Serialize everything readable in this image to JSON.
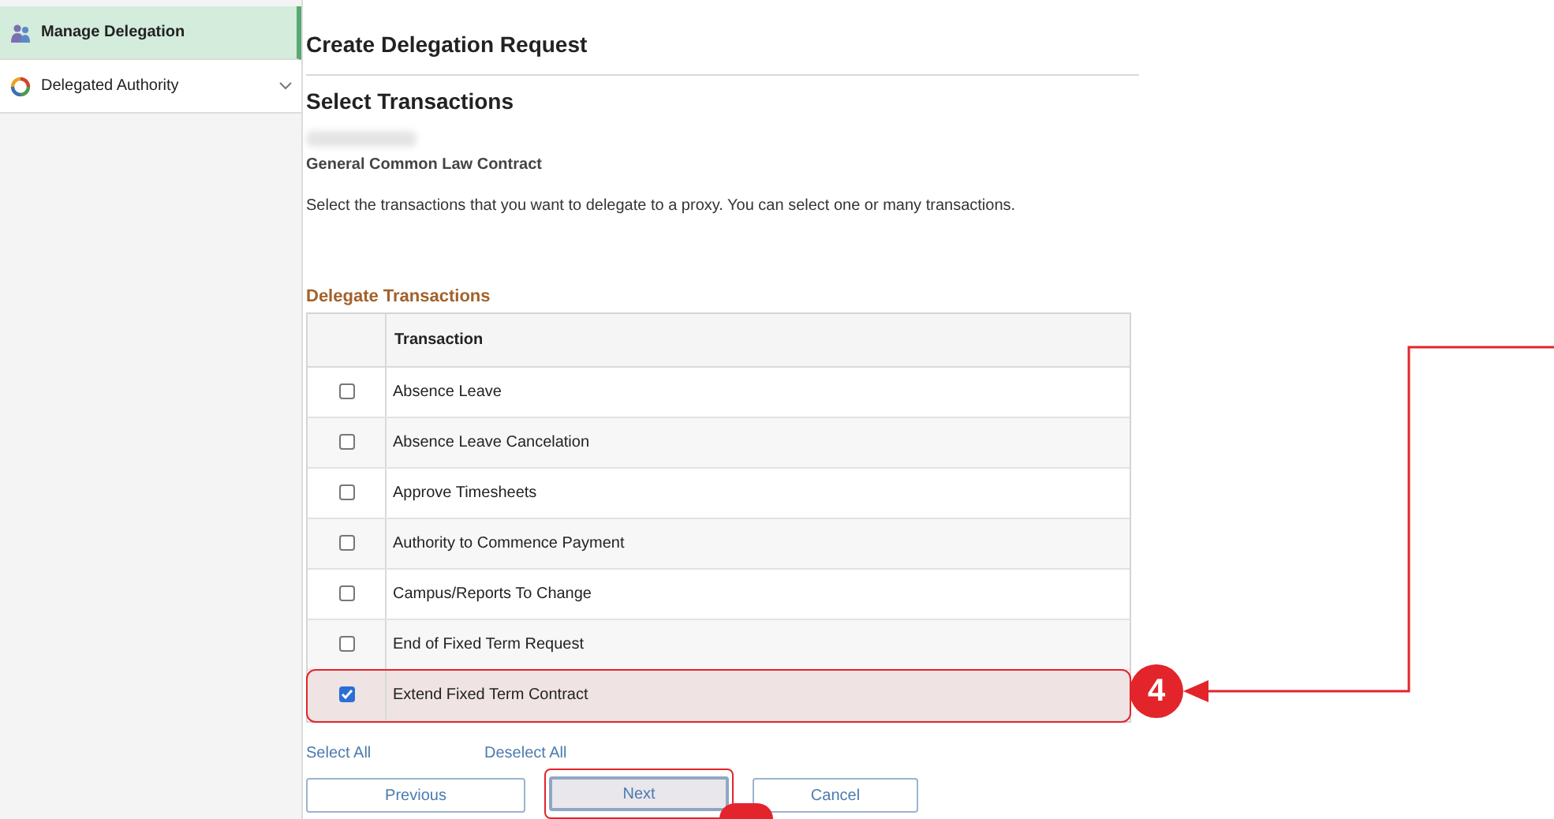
{
  "sidebar": {
    "items": [
      {
        "label": "Manage Delegation",
        "selected": true,
        "expandable": false
      },
      {
        "label": "Delegated Authority",
        "selected": false,
        "expandable": true
      }
    ]
  },
  "page": {
    "title": "Create Delegation Request",
    "subtitle": "Select Transactions",
    "contract": "General Common Law Contract",
    "instructions": "Select the transactions that you want to delegate to a proxy. You can select one or many transactions."
  },
  "grid": {
    "title": "Delegate Transactions",
    "columns": [
      "Transaction"
    ],
    "rows": [
      {
        "transaction": "Absence Leave",
        "checked": false,
        "highlighted": false
      },
      {
        "transaction": "Absence Leave Cancelation",
        "checked": false,
        "highlighted": false
      },
      {
        "transaction": "Approve Timesheets",
        "checked": false,
        "highlighted": false
      },
      {
        "transaction": "Authority to Commence Payment",
        "checked": false,
        "highlighted": false
      },
      {
        "transaction": "Campus/Reports To Change",
        "checked": false,
        "highlighted": false
      },
      {
        "transaction": "End of Fixed Term Request",
        "checked": false,
        "highlighted": false
      },
      {
        "transaction": "Extend Fixed Term Contract",
        "checked": true,
        "highlighted": true
      }
    ]
  },
  "links": [
    "Select All",
    "Deselect All"
  ],
  "buttons": [
    {
      "label": "Previous",
      "highlighted": false
    },
    {
      "label": "Next",
      "highlighted": true
    },
    {
      "label": "Cancel",
      "highlighted": false
    }
  ],
  "callout": {
    "label": "4"
  }
}
